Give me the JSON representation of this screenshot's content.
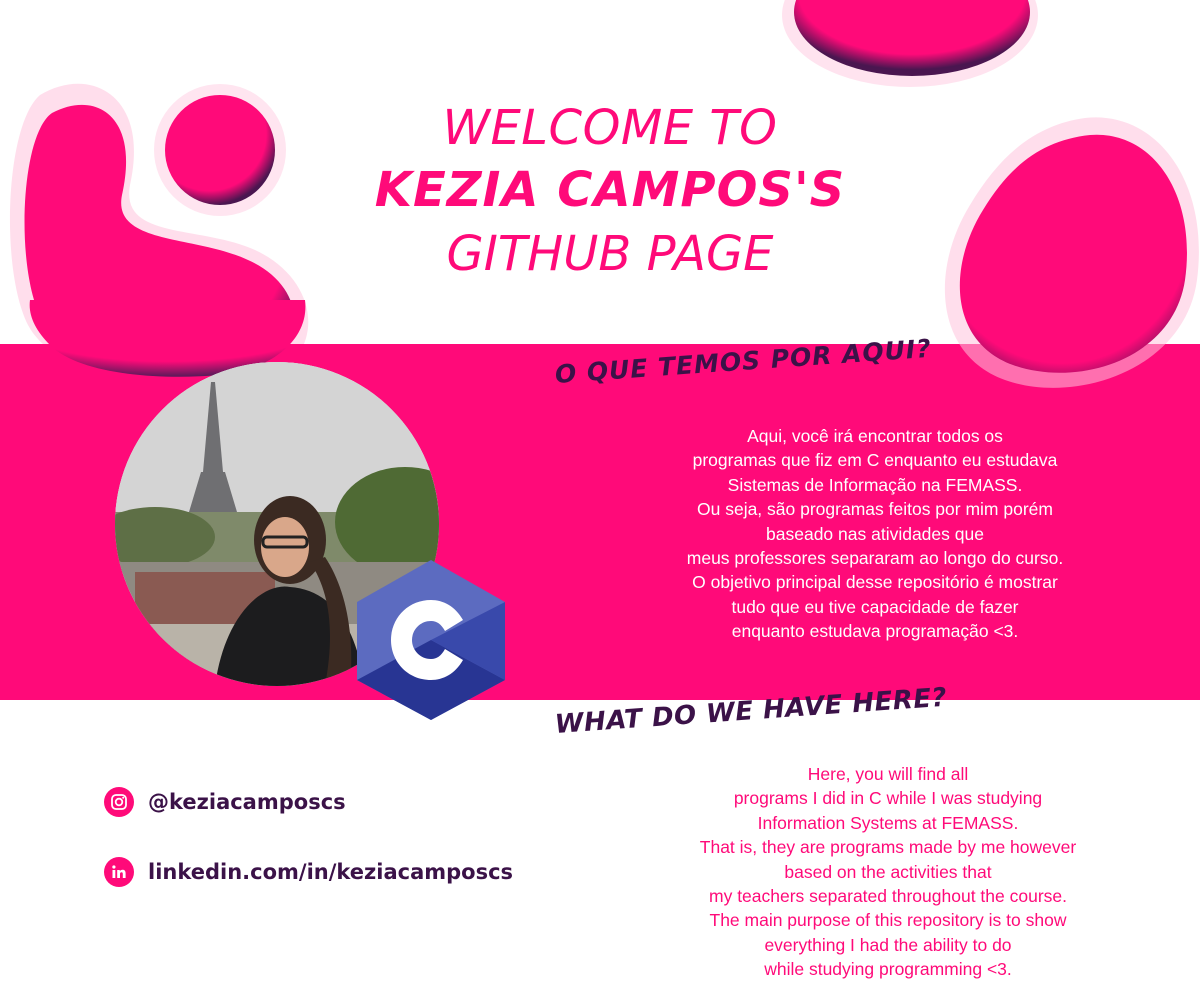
{
  "banner": {
    "title_welcome": "WELCOME",
    "title_to": "TO",
    "title_name": "KEZIA CAMPOS'S",
    "title_page": "GITHUB PAGE"
  },
  "portuguese": {
    "heading": "O QUE TEMOS POR AQUI?",
    "lines": [
      "Aqui, você irá encontrar todos os",
      "programas que fiz em C enquanto eu estudava",
      "Sistemas de Informação na FEMASS.",
      "Ou seja, são programas feitos por mim porém",
      "baseado nas atividades que",
      "meus professores separaram ao longo do curso.",
      "O objetivo principal desse repositório é mostrar",
      "tudo que eu tive capacidade de fazer",
      "enquanto estudava programação <3."
    ]
  },
  "english": {
    "heading": "WHAT DO WE HAVE HERE?",
    "lines": [
      "Here, you will find all",
      "programs I did in C while I was studying",
      "Information Systems at FEMASS.",
      "That is, they are programs made by me however",
      "based on the activities that",
      "my teachers separated throughout the course.",
      "The main purpose of this repository is to show",
      "everything I had the ability to do",
      "while studying programming <3."
    ]
  },
  "socials": {
    "instagram": {
      "icon": "instagram-icon",
      "text": "@keziacamposcs"
    },
    "linkedin": {
      "icon": "linkedin-icon",
      "text": "linkedin.com/in/keziacamposcs"
    }
  },
  "logo": {
    "letter": "C",
    "icon": "c-language-logo"
  },
  "colors": {
    "pink": "#ff0a79",
    "dark_purple": "#3b1248",
    "c_logo_light": "#5c6bc0",
    "c_logo_mid": "#3949ab",
    "c_logo_dark": "#283593"
  }
}
